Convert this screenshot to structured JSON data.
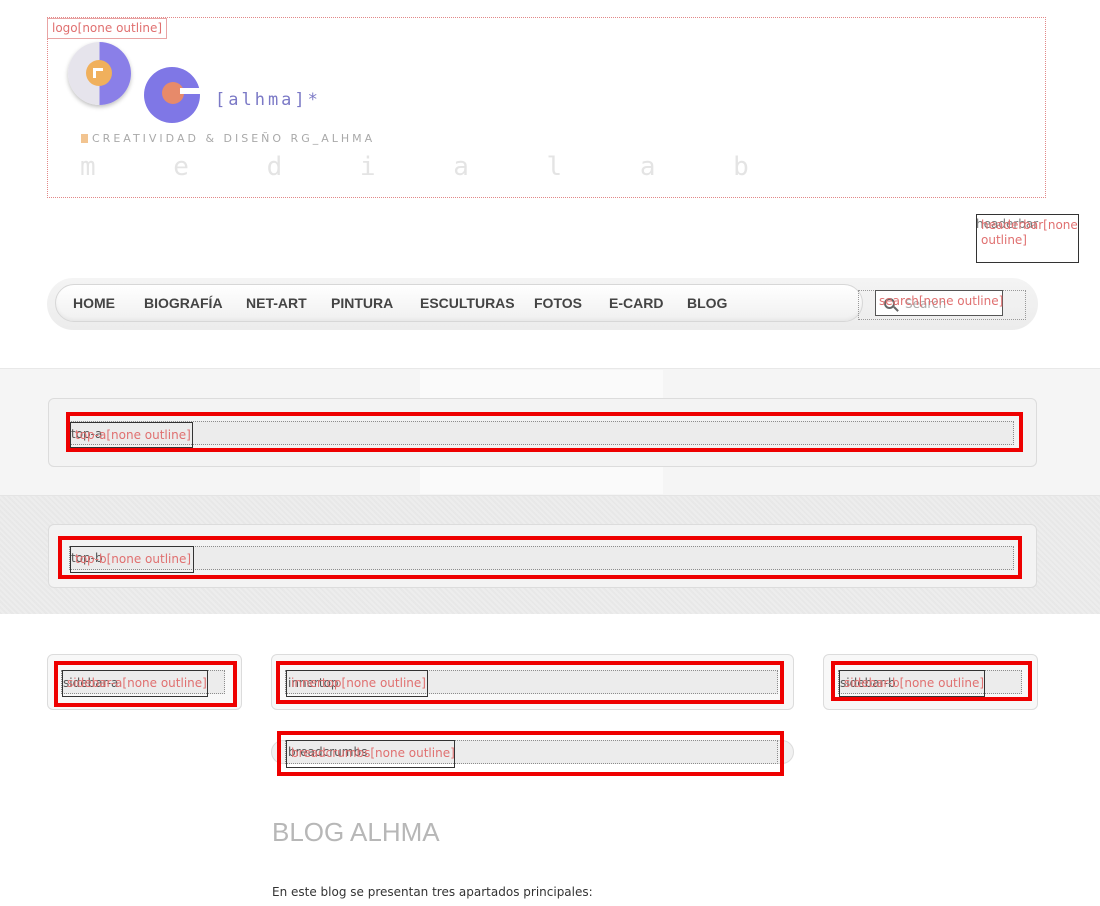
{
  "logo": {
    "debug_label": "logo[none outline]",
    "brand": "[alhma]*",
    "tagline": "CREATIVIDAD & DISEÑO RG_ALHMA",
    "wordmark": "m e d i a l a b"
  },
  "headerbar": {
    "debug_label": "headerbar[none outline]",
    "underlay": "headerbar"
  },
  "nav": {
    "items": [
      "HOME",
      "BIOGRAFÍA",
      "NET-ART",
      "PINTURA",
      "ESCULTURAS",
      "FOTOS",
      "E-CARD",
      "BLOG"
    ]
  },
  "search": {
    "placeholder": "Search",
    "debug_label": "search[none outline]"
  },
  "modules": {
    "top_a": {
      "name": "top-a",
      "debug_label": "top-a[none outline]"
    },
    "top_b": {
      "name": "top-b",
      "debug_label": "top-b[none outline]"
    },
    "sidebar_a": {
      "name": "sidebar-a",
      "debug_label": "sidebar-a[none outline]"
    },
    "innertop": {
      "name": "innertop",
      "debug_label": "innertop[none outline]"
    },
    "sidebar_b": {
      "name": "sidebar-b",
      "debug_label": "sidebar-b[none outline]"
    },
    "breadcrumbs": {
      "name": "breadcrumbs",
      "debug_label": "breadcrumbs[none outline]"
    }
  },
  "content": {
    "title": "BLOG ALHMA",
    "intro": "En este blog se presentan tres apartados principales:"
  },
  "colors": {
    "outline_red": "#ee0000",
    "label_pink": "#e07070",
    "logo_purple": "#7f77e6",
    "logo_orange": "#f0b05c"
  }
}
